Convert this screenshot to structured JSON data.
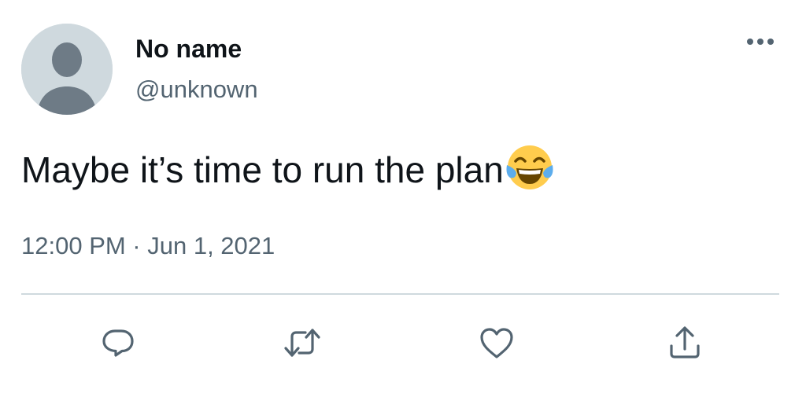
{
  "author": {
    "display_name": "No name",
    "handle": "@unknown",
    "avatar_icon": "default-avatar-icon"
  },
  "tweet": {
    "text": "Maybe it’s time to run the plan",
    "emoji": "face-with-tears-of-joy-emoji",
    "timestamp": "12:00 PM · Jun 1, 2021"
  },
  "menu": {
    "icon": "more-dots-icon"
  },
  "actions": [
    {
      "name": "reply",
      "icon": "reply-icon"
    },
    {
      "name": "retweet",
      "icon": "retweet-icon"
    },
    {
      "name": "like",
      "icon": "heart-icon"
    },
    {
      "name": "share",
      "icon": "share-icon"
    }
  ],
  "colors": {
    "text_primary": "#0f1419",
    "text_secondary": "#536471",
    "divider": "#cfd9de",
    "avatar_bg": "#cfd9de",
    "avatar_fg": "#6e7b86"
  }
}
